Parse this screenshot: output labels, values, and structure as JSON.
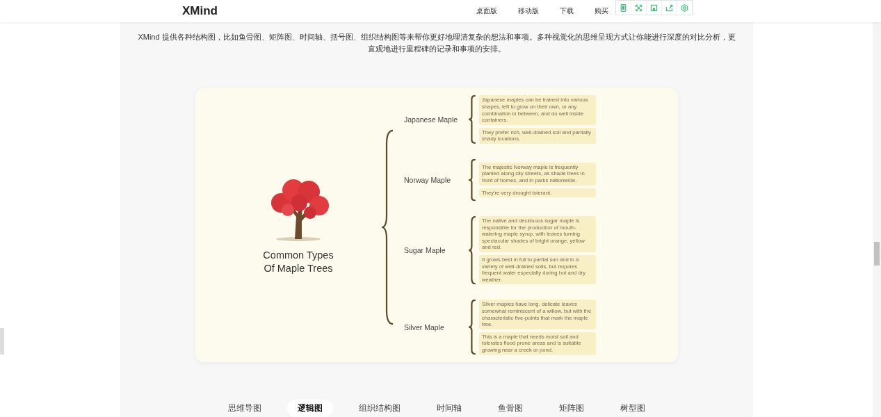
{
  "header": {
    "logo": "XMind",
    "nav": [
      "桌面版",
      "移动版",
      "下载",
      "购买"
    ]
  },
  "intro": "XMind 提供各种结构图，比如鱼骨图、矩阵图、时间轴、括号图、组织结构图等来帮你更好地理清复杂的想法和事项。多种视觉化的思维呈现方式让你能进行深度的对比分析，更直观地进行里程碑的记录和事项的安排。",
  "mindmap": {
    "title": "Common Types Of Maple Trees",
    "branches": [
      {
        "label": "Japanese Maple",
        "notes": [
          "Japanese maples can be trained into various shapes, left to grow on their own, or any combination in between, and do well inside containers.",
          "They prefer rich, well-drained soil and partially shady locations."
        ]
      },
      {
        "label": "Norway Maple",
        "notes": [
          "The majestic Norway maple is frequently planted along city streets, as shade trees in front of homes, and in parks nationwide.",
          "They're very drought tolerant."
        ]
      },
      {
        "label": "Sugar Maple",
        "notes": [
          "The native and deciduous sugar maple is responsible for the production of mouth-watering maple syrup, with leaves turning spectacular shades of bright orange, yellow and red.",
          "It grows best in full to partial sun and in a variety of well-drained soils, but requires frequent water especially during hot and dry weather."
        ]
      },
      {
        "label": "Silver Maple",
        "notes": [
          "Silver maples have long, delicate leaves somewhat reminiscent of a willow, but with the characteristic five-points that mark the maple tree.",
          "This is a maple that needs moist soil and tolerates flood prone areas and is suitable growing near a creek or pond."
        ]
      }
    ]
  },
  "tabs": [
    {
      "label": "思维导图",
      "selected": false
    },
    {
      "label": "逻辑图",
      "selected": true
    },
    {
      "label": "组织结构图",
      "selected": false
    },
    {
      "label": "时间轴",
      "selected": false
    },
    {
      "label": "鱼骨图",
      "selected": false
    },
    {
      "label": "矩阵图",
      "selected": false
    },
    {
      "label": "树型图",
      "selected": false
    }
  ]
}
